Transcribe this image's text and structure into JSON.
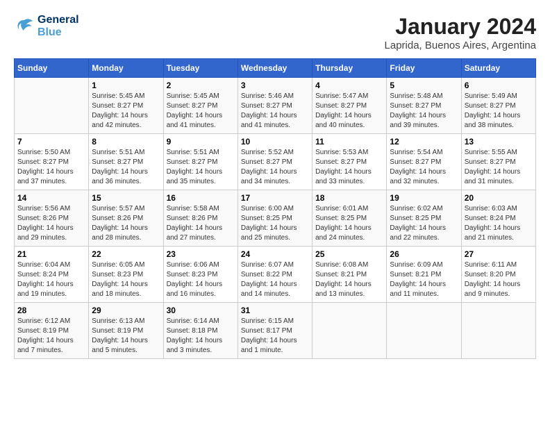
{
  "logo": {
    "line1": "General",
    "line2": "Blue"
  },
  "title": "January 2024",
  "subtitle": "Laprida, Buenos Aires, Argentina",
  "weekdays": [
    "Sunday",
    "Monday",
    "Tuesday",
    "Wednesday",
    "Thursday",
    "Friday",
    "Saturday"
  ],
  "weeks": [
    [
      {
        "day": "",
        "sunrise": "",
        "sunset": "",
        "daylight": ""
      },
      {
        "day": "1",
        "sunrise": "Sunrise: 5:45 AM",
        "sunset": "Sunset: 8:27 PM",
        "daylight": "Daylight: 14 hours and 42 minutes."
      },
      {
        "day": "2",
        "sunrise": "Sunrise: 5:45 AM",
        "sunset": "Sunset: 8:27 PM",
        "daylight": "Daylight: 14 hours and 41 minutes."
      },
      {
        "day": "3",
        "sunrise": "Sunrise: 5:46 AM",
        "sunset": "Sunset: 8:27 PM",
        "daylight": "Daylight: 14 hours and 41 minutes."
      },
      {
        "day": "4",
        "sunrise": "Sunrise: 5:47 AM",
        "sunset": "Sunset: 8:27 PM",
        "daylight": "Daylight: 14 hours and 40 minutes."
      },
      {
        "day": "5",
        "sunrise": "Sunrise: 5:48 AM",
        "sunset": "Sunset: 8:27 PM",
        "daylight": "Daylight: 14 hours and 39 minutes."
      },
      {
        "day": "6",
        "sunrise": "Sunrise: 5:49 AM",
        "sunset": "Sunset: 8:27 PM",
        "daylight": "Daylight: 14 hours and 38 minutes."
      }
    ],
    [
      {
        "day": "7",
        "sunrise": "Sunrise: 5:50 AM",
        "sunset": "Sunset: 8:27 PM",
        "daylight": "Daylight: 14 hours and 37 minutes."
      },
      {
        "day": "8",
        "sunrise": "Sunrise: 5:51 AM",
        "sunset": "Sunset: 8:27 PM",
        "daylight": "Daylight: 14 hours and 36 minutes."
      },
      {
        "day": "9",
        "sunrise": "Sunrise: 5:51 AM",
        "sunset": "Sunset: 8:27 PM",
        "daylight": "Daylight: 14 hours and 35 minutes."
      },
      {
        "day": "10",
        "sunrise": "Sunrise: 5:52 AM",
        "sunset": "Sunset: 8:27 PM",
        "daylight": "Daylight: 14 hours and 34 minutes."
      },
      {
        "day": "11",
        "sunrise": "Sunrise: 5:53 AM",
        "sunset": "Sunset: 8:27 PM",
        "daylight": "Daylight: 14 hours and 33 minutes."
      },
      {
        "day": "12",
        "sunrise": "Sunrise: 5:54 AM",
        "sunset": "Sunset: 8:27 PM",
        "daylight": "Daylight: 14 hours and 32 minutes."
      },
      {
        "day": "13",
        "sunrise": "Sunrise: 5:55 AM",
        "sunset": "Sunset: 8:27 PM",
        "daylight": "Daylight: 14 hours and 31 minutes."
      }
    ],
    [
      {
        "day": "14",
        "sunrise": "Sunrise: 5:56 AM",
        "sunset": "Sunset: 8:26 PM",
        "daylight": "Daylight: 14 hours and 29 minutes."
      },
      {
        "day": "15",
        "sunrise": "Sunrise: 5:57 AM",
        "sunset": "Sunset: 8:26 PM",
        "daylight": "Daylight: 14 hours and 28 minutes."
      },
      {
        "day": "16",
        "sunrise": "Sunrise: 5:58 AM",
        "sunset": "Sunset: 8:26 PM",
        "daylight": "Daylight: 14 hours and 27 minutes."
      },
      {
        "day": "17",
        "sunrise": "Sunrise: 6:00 AM",
        "sunset": "Sunset: 8:25 PM",
        "daylight": "Daylight: 14 hours and 25 minutes."
      },
      {
        "day": "18",
        "sunrise": "Sunrise: 6:01 AM",
        "sunset": "Sunset: 8:25 PM",
        "daylight": "Daylight: 14 hours and 24 minutes."
      },
      {
        "day": "19",
        "sunrise": "Sunrise: 6:02 AM",
        "sunset": "Sunset: 8:25 PM",
        "daylight": "Daylight: 14 hours and 22 minutes."
      },
      {
        "day": "20",
        "sunrise": "Sunrise: 6:03 AM",
        "sunset": "Sunset: 8:24 PM",
        "daylight": "Daylight: 14 hours and 21 minutes."
      }
    ],
    [
      {
        "day": "21",
        "sunrise": "Sunrise: 6:04 AM",
        "sunset": "Sunset: 8:24 PM",
        "daylight": "Daylight: 14 hours and 19 minutes."
      },
      {
        "day": "22",
        "sunrise": "Sunrise: 6:05 AM",
        "sunset": "Sunset: 8:23 PM",
        "daylight": "Daylight: 14 hours and 18 minutes."
      },
      {
        "day": "23",
        "sunrise": "Sunrise: 6:06 AM",
        "sunset": "Sunset: 8:23 PM",
        "daylight": "Daylight: 14 hours and 16 minutes."
      },
      {
        "day": "24",
        "sunrise": "Sunrise: 6:07 AM",
        "sunset": "Sunset: 8:22 PM",
        "daylight": "Daylight: 14 hours and 14 minutes."
      },
      {
        "day": "25",
        "sunrise": "Sunrise: 6:08 AM",
        "sunset": "Sunset: 8:21 PM",
        "daylight": "Daylight: 14 hours and 13 minutes."
      },
      {
        "day": "26",
        "sunrise": "Sunrise: 6:09 AM",
        "sunset": "Sunset: 8:21 PM",
        "daylight": "Daylight: 14 hours and 11 minutes."
      },
      {
        "day": "27",
        "sunrise": "Sunrise: 6:11 AM",
        "sunset": "Sunset: 8:20 PM",
        "daylight": "Daylight: 14 hours and 9 minutes."
      }
    ],
    [
      {
        "day": "28",
        "sunrise": "Sunrise: 6:12 AM",
        "sunset": "Sunset: 8:19 PM",
        "daylight": "Daylight: 14 hours and 7 minutes."
      },
      {
        "day": "29",
        "sunrise": "Sunrise: 6:13 AM",
        "sunset": "Sunset: 8:19 PM",
        "daylight": "Daylight: 14 hours and 5 minutes."
      },
      {
        "day": "30",
        "sunrise": "Sunrise: 6:14 AM",
        "sunset": "Sunset: 8:18 PM",
        "daylight": "Daylight: 14 hours and 3 minutes."
      },
      {
        "day": "31",
        "sunrise": "Sunrise: 6:15 AM",
        "sunset": "Sunset: 8:17 PM",
        "daylight": "Daylight: 14 hours and 1 minute."
      },
      {
        "day": "",
        "sunrise": "",
        "sunset": "",
        "daylight": ""
      },
      {
        "day": "",
        "sunrise": "",
        "sunset": "",
        "daylight": ""
      },
      {
        "day": "",
        "sunrise": "",
        "sunset": "",
        "daylight": ""
      }
    ]
  ]
}
